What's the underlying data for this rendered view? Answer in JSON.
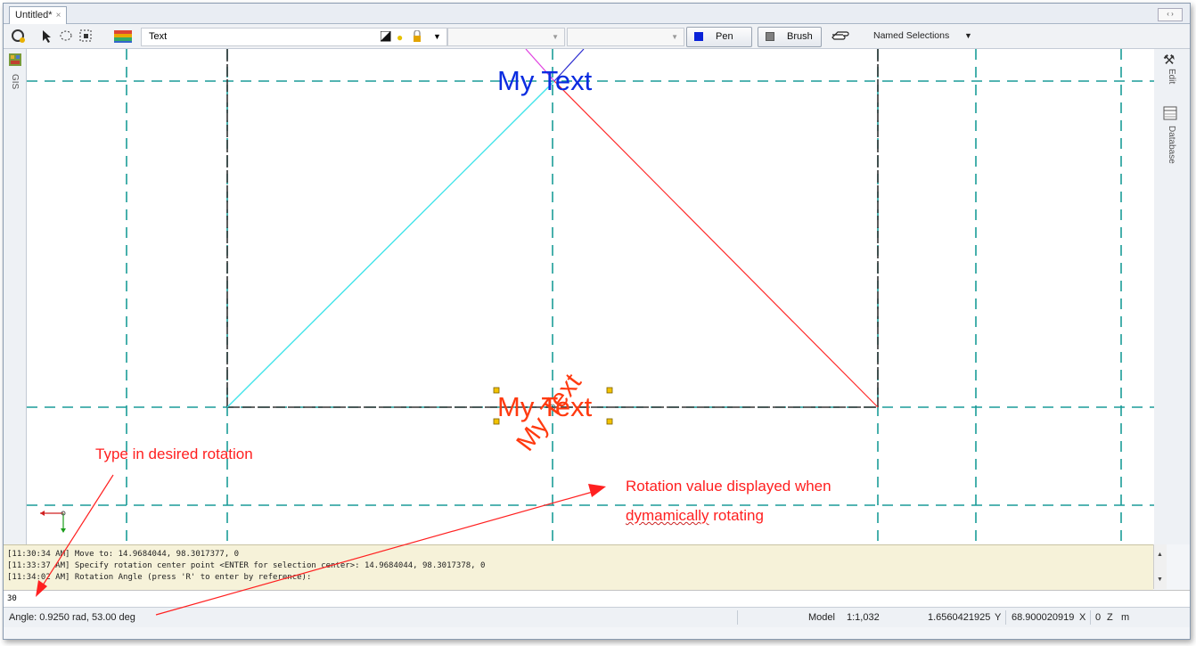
{
  "tab": {
    "title": "Untitled*",
    "close": "×",
    "nav": "‹ ›"
  },
  "toolbar": {
    "layer_name": "Text",
    "pen_label": "Pen",
    "brush_label": "Brush",
    "named_selections_label": "Named Selections",
    "pen_color": "#0a22d8",
    "brush_color": "#808080"
  },
  "side_panels": {
    "left": "GIS",
    "right_edit": "Edit",
    "right_database": "Database"
  },
  "canvas": {
    "text_top": "My Text",
    "text_bottom": "My Text",
    "text_rotated": "My Text",
    "text_top_color": "#0b2ce0",
    "text_red_color": "#ff3a10"
  },
  "command_log": [
    "[11:30:34 AM] Move to: 14.9684044, 98.3017377, 0",
    "[11:33:37 AM] Specify rotation center point <ENTER for selection center>: 14.9684044, 98.3017378, 0",
    "[11:34:02 AM] Rotation Angle (press 'R' to enter by reference):"
  ],
  "command_input": {
    "value": "30"
  },
  "status": {
    "angle": "Angle: 0.9250 rad, 53.00 deg",
    "space": "Model",
    "scale": "1:1,032",
    "y_value": "1.6560421925",
    "y_label": "Y",
    "x_value": "68.900020919",
    "x_label": "X",
    "z_value": "0",
    "z_label": "Z",
    "units": "m"
  },
  "annotations": {
    "type_rotation": "Type in desired rotation",
    "rotation_value_line1": "Rotation value displayed when",
    "rotation_value_line2_a": "dymamically",
    "rotation_value_line2_b": " rotating",
    "color": "#ff2020"
  }
}
